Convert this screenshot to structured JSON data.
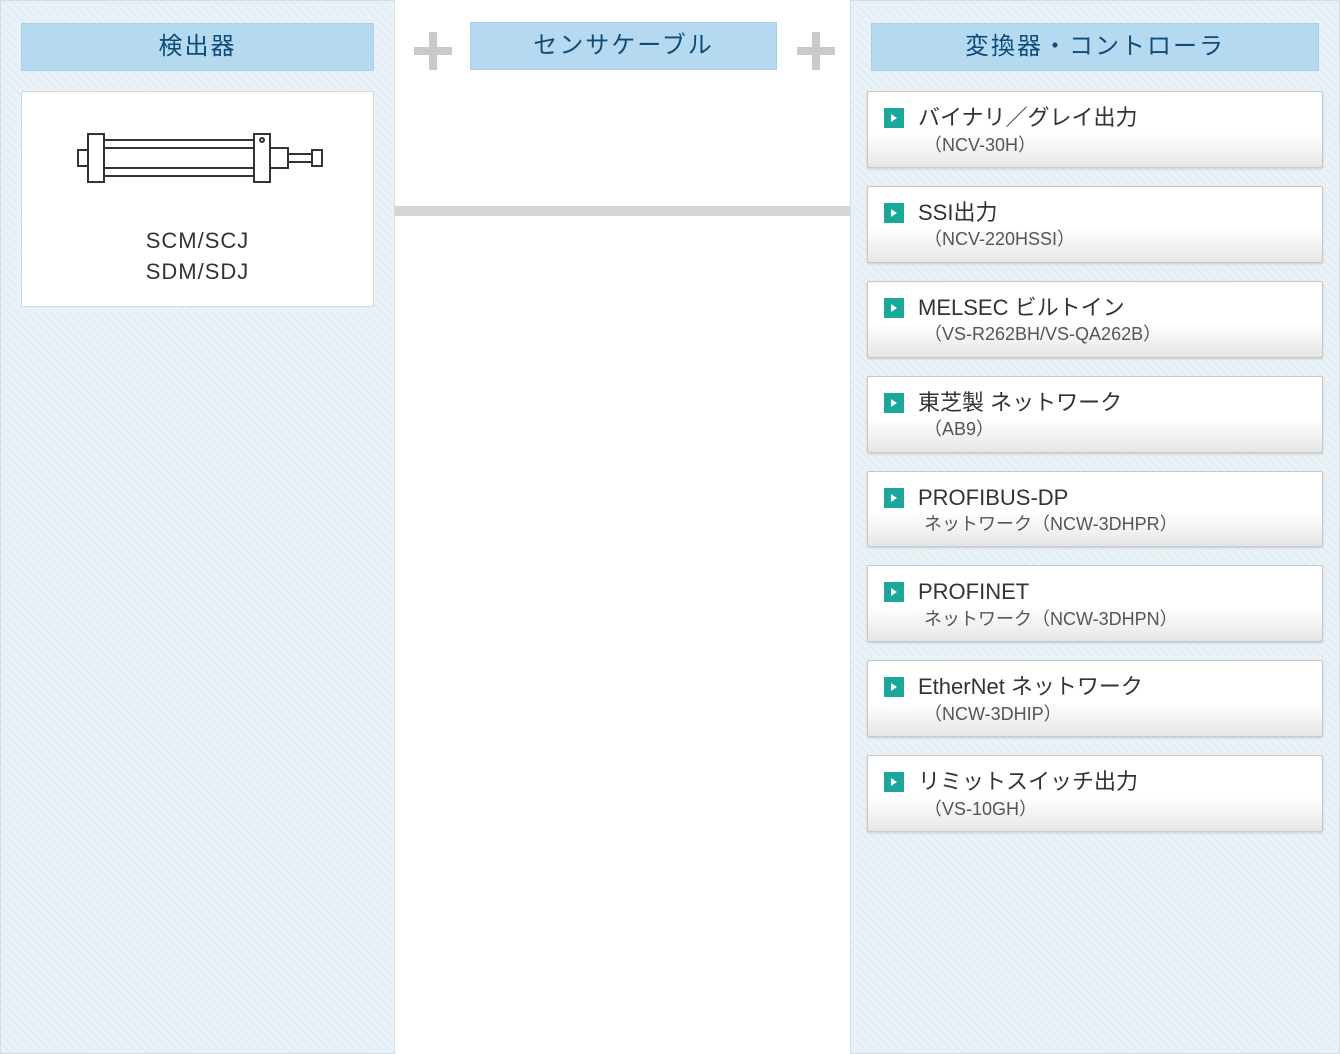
{
  "columns": {
    "detector": {
      "heading": "検出器"
    },
    "cable": {
      "heading": "センサケーブル"
    },
    "converter": {
      "heading": "変換器・コントローラ"
    }
  },
  "detector_card": {
    "line1": "SCM/SCJ",
    "line2": "SDM/SDJ"
  },
  "converter_items": [
    {
      "title": "バイナリ／グレイ出力",
      "sub": "（NCV-30H）"
    },
    {
      "title": "SSI出力",
      "sub": "（NCV-220HSSI）"
    },
    {
      "title": "MELSEC ビルトイン",
      "sub": "（VS-R262BH/VS-QA262B）"
    },
    {
      "title": "東芝製 ネットワーク",
      "sub": "（AB9）"
    },
    {
      "title": "PROFIBUS-DP",
      "sub": "ネットワーク（NCW-3DHPR）"
    },
    {
      "title": "PROFINET",
      "sub": "ネットワーク（NCW-3DHPN）"
    },
    {
      "title": "EtherNet ネットワーク",
      "sub": "（NCW-3DHIP）"
    },
    {
      "title": "リミットスイッチ出力",
      "sub": "（VS-10GH）"
    }
  ]
}
